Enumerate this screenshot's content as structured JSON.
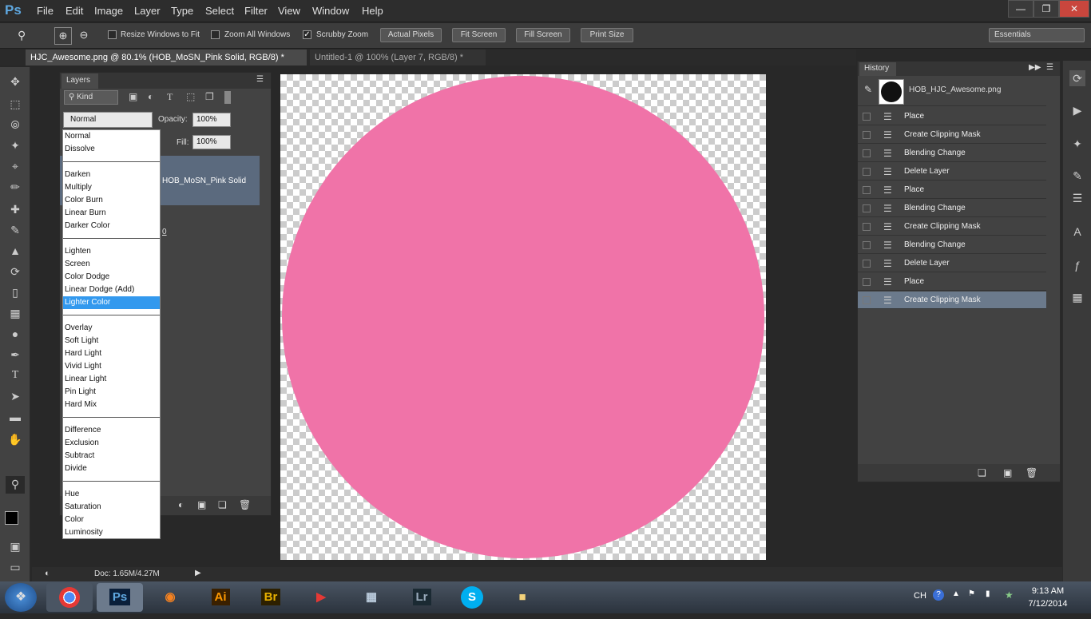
{
  "app": {
    "logo": "Ps"
  },
  "menu": [
    "File",
    "Edit",
    "Image",
    "Layer",
    "Type",
    "Select",
    "Filter",
    "View",
    "Window",
    "Help"
  ],
  "window_controls": [
    "minimize",
    "restore",
    "close"
  ],
  "options": {
    "resize_windows": "Resize Windows to Fit",
    "zoom_all": "Zoom All Windows",
    "scrubby": "Scrubby Zoom",
    "actual_pixels": "Actual Pixels",
    "fit_screen": "Fit Screen",
    "fill_screen": "Fill Screen",
    "print_size": "Print Size",
    "workspace": "Essentials"
  },
  "tabs": [
    {
      "label": "HJC_Awesome.png @ 80.1% (HOB_MoSN_Pink Solid, RGB/8) *",
      "active": true
    },
    {
      "label": "Untitled-1 @ 100% (Layer 7, RGB/8) *",
      "active": false
    }
  ],
  "layers": {
    "title": "Layers",
    "kind": "Kind",
    "blend_mode": "Normal",
    "opacity_label": "Opacity:",
    "opacity": "100%",
    "fill_label": "Fill:",
    "fill": "100%",
    "layer_name": "HOB_MoSN_Pink Solid",
    "layer_other": "0"
  },
  "blend_groups": [
    [
      "Normal",
      "Dissolve"
    ],
    [
      "Darken",
      "Multiply",
      "Color Burn",
      "Linear Burn",
      "Darker Color"
    ],
    [
      "Lighten",
      "Screen",
      "Color Dodge",
      "Linear Dodge (Add)",
      "Lighter Color"
    ],
    [
      "Overlay",
      "Soft Light",
      "Hard Light",
      "Vivid Light",
      "Linear Light",
      "Pin Light",
      "Hard Mix"
    ],
    [
      "Difference",
      "Exclusion",
      "Subtract",
      "Divide"
    ],
    [
      "Hue",
      "Saturation",
      "Color",
      "Luminosity"
    ]
  ],
  "blend_selected": "Lighter Color",
  "history": {
    "title": "History",
    "snapshot": "HOB_HJC_Awesome.png",
    "items": [
      "Place",
      "Create Clipping Mask",
      "Blending Change",
      "Delete Layer",
      "Place",
      "Blending Change",
      "Create Clipping Mask",
      "Blending Change",
      "Delete Layer",
      "Place",
      "Create Clipping Mask"
    ],
    "selected_index": 10
  },
  "status": {
    "doc": "Doc: 1.65M/4.27M"
  },
  "taskbar": {
    "apps": [
      "chrome",
      "photoshop",
      "firefox",
      "illustrator",
      "bridge",
      "media",
      "calculator",
      "lightroom",
      "skype",
      "explorer"
    ],
    "lang": "CH",
    "time": "9:13 AM",
    "date": "7/12/2014"
  },
  "colors": {
    "pink": "#f073a8",
    "selection": "#3399ee"
  }
}
